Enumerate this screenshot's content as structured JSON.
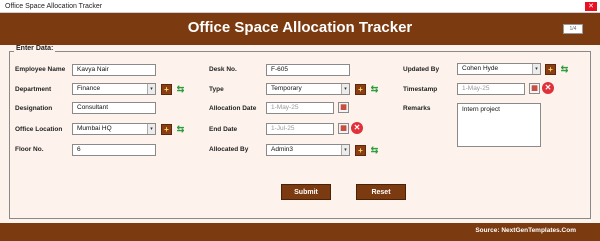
{
  "window": {
    "title": "Office Space Allocation Tracker",
    "close": "✕"
  },
  "header": {
    "title": "Office Space Allocation Tracker",
    "small_box": "1/4"
  },
  "panel": {
    "legend": "Enter Data:"
  },
  "fields": {
    "employee_name": {
      "label": "Employee Name",
      "value": "Kavya Nair"
    },
    "department": {
      "label": "Department",
      "value": "Finance"
    },
    "designation": {
      "label": "Designation",
      "value": "Consultant"
    },
    "office_location": {
      "label": "Office Location",
      "value": "Mumbai HQ"
    },
    "floor_no": {
      "label": "Floor No.",
      "value": "6"
    },
    "desk_no": {
      "label": "Desk No.",
      "value": "F-605"
    },
    "type": {
      "label": "Type",
      "value": "Temporary"
    },
    "allocation_date": {
      "label": "Allocation Date",
      "value": "1-May-25"
    },
    "end_date": {
      "label": "End Date",
      "value": "1-Jul-25"
    },
    "allocated_by": {
      "label": "Allocated By",
      "value": "Admin3"
    },
    "updated_by": {
      "label": "Updated By",
      "value": "Cohen Hyde"
    },
    "timestamp": {
      "label": "Timestamp",
      "value": "1-May-25"
    },
    "remarks": {
      "label": "Remarks",
      "value": "Intern project"
    }
  },
  "icons": {
    "plus": "+",
    "refresh": "⇆",
    "calendar": "▦",
    "clear": "✕",
    "dropdown": "▾"
  },
  "buttons": {
    "submit": "Submit",
    "reset": "Reset"
  },
  "footer": {
    "source": "Source: NextGenTemplates.Com"
  },
  "colors": {
    "brand": "#7b3a10",
    "background": "#fdf3ec"
  }
}
